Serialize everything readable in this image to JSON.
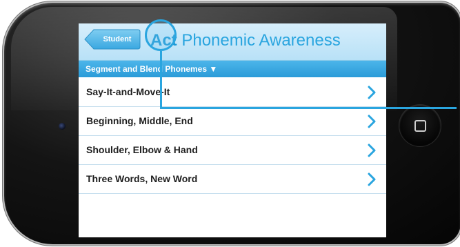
{
  "navbar": {
    "back_label": "Student",
    "title_bold": "Act",
    "title_rest": " Phonemic Awareness"
  },
  "subbar": {
    "label": "Segment and Blend Phonemes ▼"
  },
  "list": {
    "items": [
      {
        "label": "Say-It-and-Move-It",
        "icon": "chevron-right-icon"
      },
      {
        "label": "Beginning, Middle, End",
        "icon": "chevron-right-icon"
      },
      {
        "label": "Shoulder, Elbow & Hand",
        "icon": "chevron-right-icon"
      },
      {
        "label": "Three Words, New Word",
        "icon": "chevron-right-icon"
      }
    ]
  },
  "colors": {
    "accent": "#2aa5df",
    "navbar_bg": "#c8e8f9",
    "subbar_bg": "#3aa8e1",
    "back_button": "#5bbcec",
    "row_text": "#1e1e1e",
    "device_body": "#0d0d0d"
  }
}
